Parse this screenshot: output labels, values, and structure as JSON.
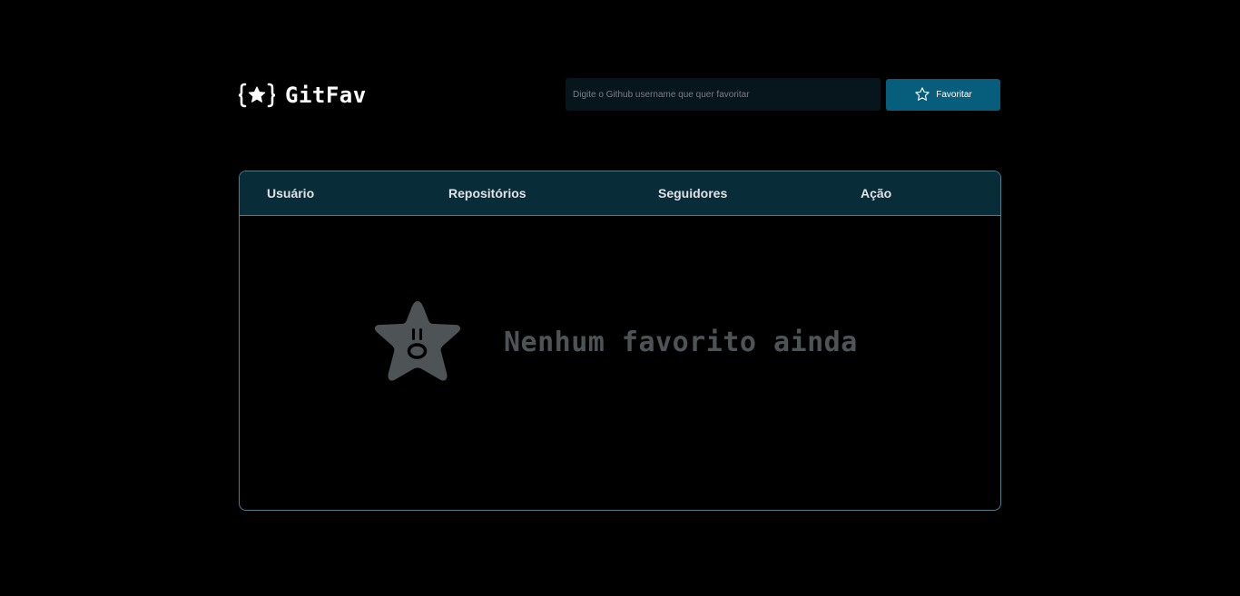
{
  "header": {
    "logo_icon": "braces-star-icon",
    "app_name": "GitFav",
    "search": {
      "placeholder": "Digite o Github username que quer favoritar",
      "value": ""
    },
    "favorite_button": {
      "icon": "star-outline-icon",
      "label": "Favoritar"
    }
  },
  "table": {
    "columns": [
      "Usuário",
      "Repositórios",
      "Seguidores",
      "Ação"
    ],
    "rows": [],
    "empty_state": {
      "icon": "sad-star-icon",
      "message": "Nenhum favorito ainda"
    }
  },
  "colors": {
    "background": "#000000",
    "accent": "#065E7C",
    "table_header": "#092D38",
    "border": "#4A808C",
    "empty_text": "#4E5455"
  }
}
